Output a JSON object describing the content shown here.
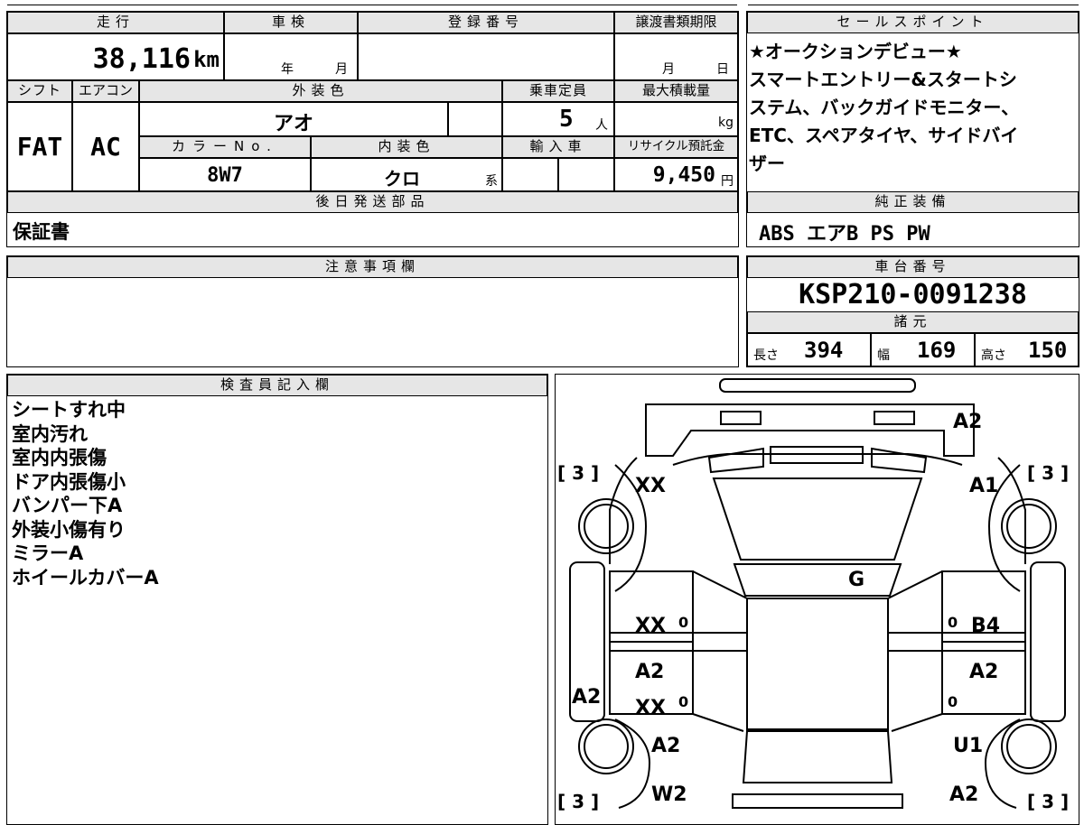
{
  "mileage": {
    "label": "走行",
    "value": "38,116",
    "unit": "km"
  },
  "inspection": {
    "label": "車検",
    "year_unit": "年",
    "month_unit": "月"
  },
  "registration": {
    "label": "登録番号",
    "value": ""
  },
  "transfer_deadline": {
    "label": "譲渡書類期限",
    "month_unit": "月",
    "day_unit": "日"
  },
  "sales_points": {
    "label": "セールスポイント",
    "lines": [
      "★オークションデビュー★",
      "スマートエントリー&スタートシ",
      "ステム、バックガイドモニター、",
      "ETC、スペアタイヤ、サイドバイ",
      "ザー"
    ]
  },
  "shift": {
    "label": "シフト",
    "value": "FAT"
  },
  "aircon": {
    "label": "エアコン",
    "value": "AC"
  },
  "exterior_color": {
    "label": "外装色",
    "value": "アオ"
  },
  "capacity": {
    "label": "乗車定員",
    "value": "5",
    "unit": "人"
  },
  "max_load": {
    "label": "最大積載量",
    "unit": "kg"
  },
  "color_no": {
    "label": "カラーNo.",
    "value": "8W7"
  },
  "interior_color": {
    "label": "内装色",
    "value": "クロ",
    "suffix": "系"
  },
  "import": {
    "label": "輸入車"
  },
  "recycle_fee": {
    "label": "リサイクル預託金",
    "value": "9,450",
    "unit": "円"
  },
  "later_parts": {
    "label": "後日発送部品",
    "value": "保証書"
  },
  "genuine_equipment": {
    "label": "純正装備",
    "value": "ABS エアB PS PW"
  },
  "remarks": {
    "label": "注意事項欄",
    "value": ""
  },
  "chassis": {
    "label": "車台番号",
    "value": "KSP210-0091238"
  },
  "specs": {
    "label": "諸元",
    "length_label": "長さ",
    "length": "394",
    "width_label": "幅",
    "width": "169",
    "height_label": "高さ",
    "height": "150"
  },
  "inspector": {
    "label": "検査員記入欄",
    "notes": [
      "シートすれ中",
      "室内汚れ",
      "室内内張傷",
      "ドア内張傷小",
      "バンパー下A",
      "外装小傷有り",
      "ミラーA",
      "ホイールカバーA"
    ]
  },
  "diagram": {
    "tire_marks": [
      "[ 3 ]",
      "[ 3 ]",
      "[ 3 ]",
      "[ 3 ]"
    ],
    "damage_codes": {
      "rear_bumper": "A2",
      "left_rear_quarter": "XX",
      "right_rear_quarter": "A1",
      "roof": "G",
      "left_rear_door": "XX",
      "right_rear_door": "B4",
      "left_front_door_a": "A2",
      "left_front_door_b": "XX",
      "right_front_door": "A2",
      "left_rocker": "A2",
      "left_front_fender": "A2",
      "right_front_fender": "U1",
      "left_front_bumper": "W2",
      "right_front_bumper": "A2"
    },
    "zero_marks": [
      "0",
      "0",
      "0",
      "0"
    ]
  }
}
